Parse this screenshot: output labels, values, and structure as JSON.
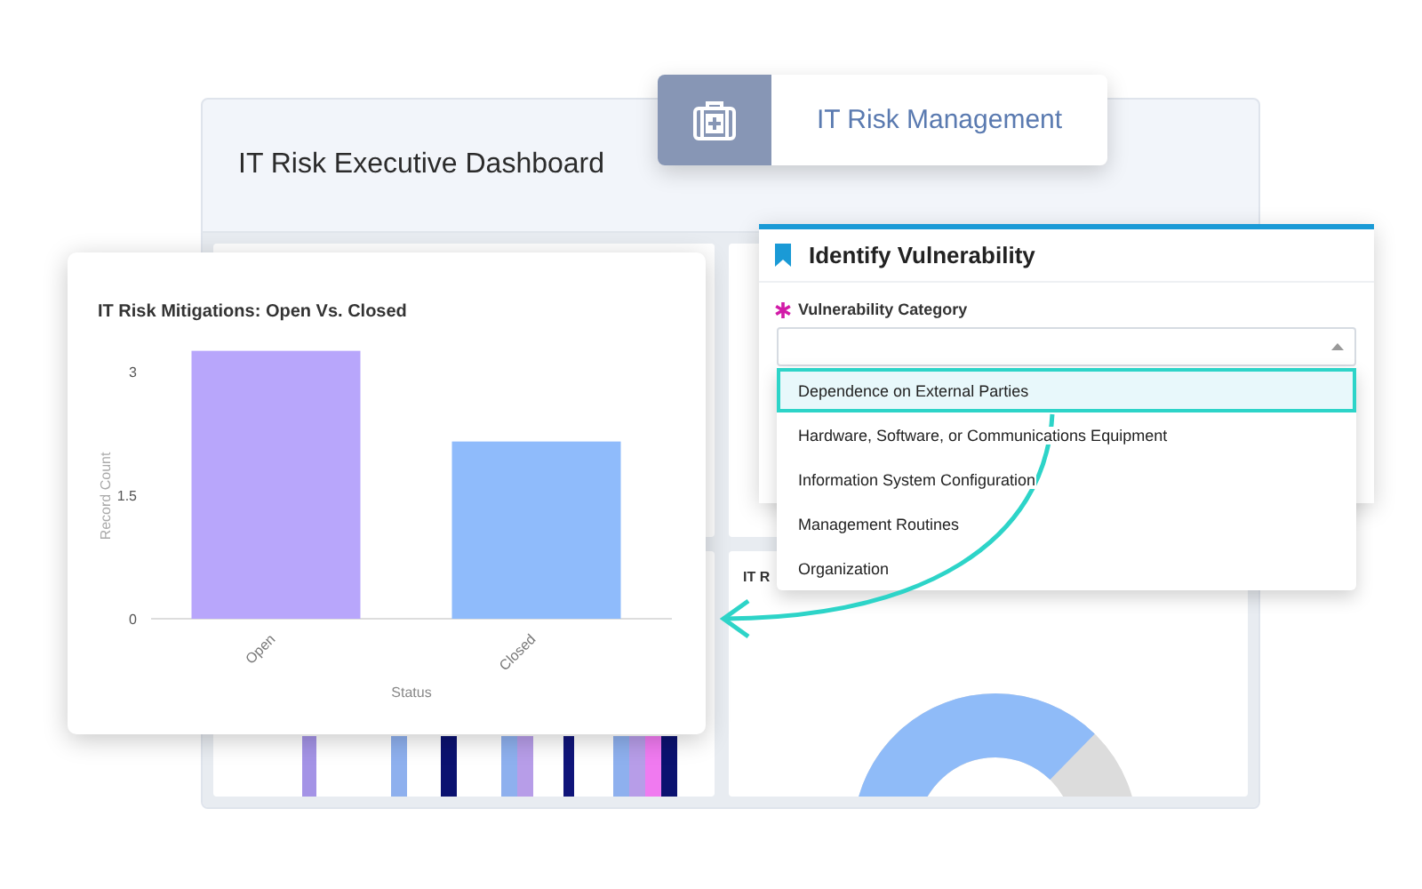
{
  "dashboard": {
    "title": "IT Risk Executive Dashboard",
    "panel_title": "IT R"
  },
  "app_badge": {
    "title": "IT Risk Management"
  },
  "chart_card": {
    "title": "IT Risk Mitigations: Open Vs. Closed",
    "chart_data": {
      "type": "bar",
      "xlabel": "Status",
      "ylabel": "Record Count",
      "categories": [
        "Open",
        "Closed"
      ],
      "series": [
        {
          "color": "#b8a6fb",
          "values": [
            3.25,
            null
          ]
        },
        {
          "color": "#8fbbfb",
          "values": [
            null,
            2.15
          ]
        }
      ],
      "ylim": [
        0,
        3.3
      ],
      "yticks": [
        0,
        1.5,
        3
      ]
    }
  },
  "form": {
    "title": "Identify Vulnerability",
    "field": {
      "label": "Vulnerability Category",
      "required": true
    },
    "options": [
      {
        "label": "Dependence on External Parties",
        "selected": true
      },
      {
        "label": "Hardware, Software, or Communications Equipment",
        "selected": false
      },
      {
        "label": "Information System Configuration",
        "selected": false
      },
      {
        "label": "Management Routines",
        "selected": false
      },
      {
        "label": "Organization",
        "selected": false
      }
    ]
  }
}
